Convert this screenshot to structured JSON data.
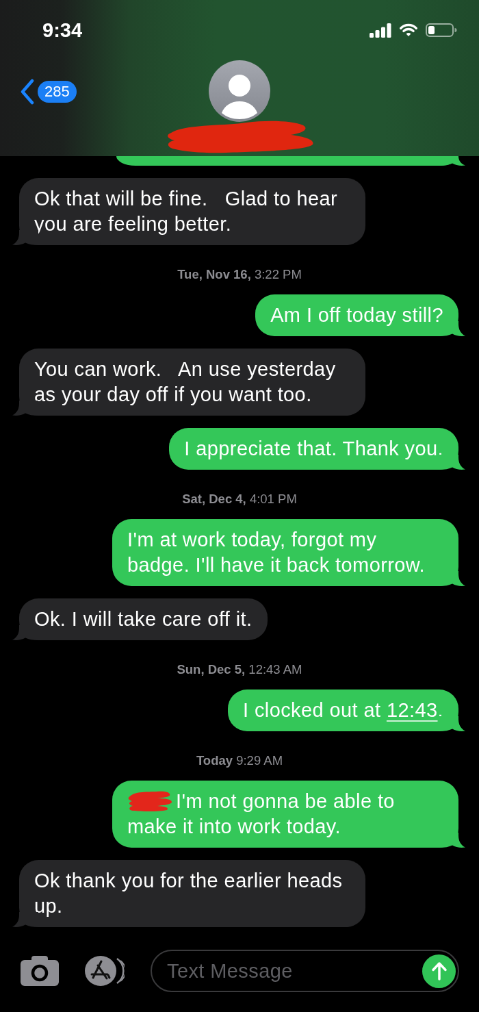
{
  "status_bar": {
    "time": "9:34"
  },
  "header": {
    "back_count": "285",
    "name_scribbled": true
  },
  "thread": [
    {
      "kind": "sent_partial"
    },
    {
      "kind": "received",
      "text": "Ok that will be fine.   Glad to hear you are feeling better."
    },
    {
      "kind": "timestamp",
      "text": "**Tue, Nov 16,** 3:22 PM"
    },
    {
      "kind": "sent",
      "text": "Am I off today still?"
    },
    {
      "kind": "received",
      "text": "You can work.   An use yesterday as your day off if you want too."
    },
    {
      "kind": "sent",
      "text": "I appreciate that. Thank you."
    },
    {
      "kind": "timestamp",
      "text": "**Sat, Dec 4,** 4:01 PM"
    },
    {
      "kind": "sent",
      "text": "I'm at work today, forgot my badge. I'll have it back tomorrow."
    },
    {
      "kind": "received",
      "text": "Ok. I will take care off it."
    },
    {
      "kind": "timestamp",
      "text": "**Sun, Dec 5,** 12:43 AM"
    },
    {
      "kind": "sent",
      "parts": [
        {
          "kind": "text",
          "text": "I clocked out at "
        },
        {
          "kind": "link",
          "text": "12:43"
        },
        {
          "kind": "text",
          "text": "."
        }
      ]
    },
    {
      "kind": "timestamp",
      "text": "**Today** 9:29 AM"
    },
    {
      "kind": "sent",
      "scribbled_start": true,
      "text": "I'm not gonna be able to make it into work today."
    },
    {
      "kind": "received",
      "text": "Ok thank you for the earlier heads up."
    }
  ],
  "composer": {
    "placeholder": "Text Message"
  }
}
